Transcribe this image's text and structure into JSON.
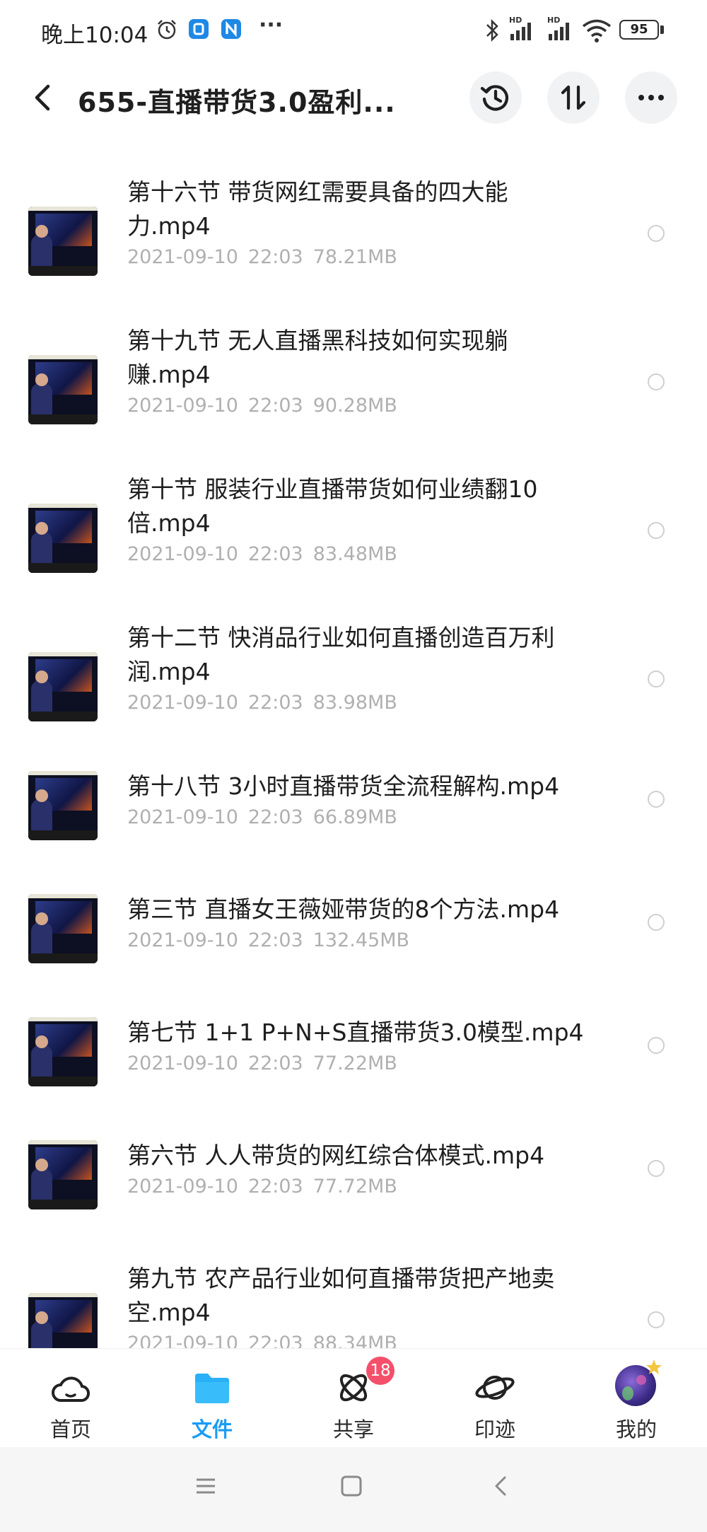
{
  "status_bar": {
    "time": "晚上10:04",
    "more": "···",
    "signal_1_label": "HD",
    "signal_2_label": "HD",
    "battery": "95"
  },
  "header": {
    "title": "655-直播带货3.0盈利..."
  },
  "files": [
    {
      "name": "第十六节 带货网红需要具备的四大能力.mp4",
      "date": "2021-09-10",
      "time": "22:03",
      "size": "78.21MB"
    },
    {
      "name": "第十九节 无人直播黑科技如何实现躺赚.mp4",
      "date": "2021-09-10",
      "time": "22:03",
      "size": "90.28MB"
    },
    {
      "name": "第十节 服装行业直播带货如何业绩翻10倍.mp4",
      "date": "2021-09-10",
      "time": "22:03",
      "size": "83.48MB"
    },
    {
      "name": "第十二节 快消品行业如何直播创造百万利润.mp4",
      "date": "2021-09-10",
      "time": "22:03",
      "size": "83.98MB"
    },
    {
      "name": "第十八节 3小时直播带货全流程解构.mp4",
      "date": "2021-09-10",
      "time": "22:03",
      "size": "66.89MB"
    },
    {
      "name": "第三节 直播女王薇娅带货的8个方法.mp4",
      "date": "2021-09-10",
      "time": "22:03",
      "size": "132.45MB"
    },
    {
      "name": "第七节 1+1 P+N+S直播带货3.0模型.mp4",
      "date": "2021-09-10",
      "time": "22:03",
      "size": "77.22MB"
    },
    {
      "name": "第六节 人人带货的网红综合体模式.mp4",
      "date": "2021-09-10",
      "time": "22:03",
      "size": "77.72MB"
    },
    {
      "name": "第九节 农产品行业如何直播带货把产地卖空.mp4",
      "date": "2021-09-10",
      "time": "22:03",
      "size": "88.34MB"
    }
  ],
  "tabs": [
    {
      "label": "首页",
      "icon": "cloud-icon"
    },
    {
      "label": "文件",
      "icon": "folder-icon",
      "active": true
    },
    {
      "label": "共享",
      "icon": "atom-icon",
      "badge": "18"
    },
    {
      "label": "印迹",
      "icon": "planet-icon"
    },
    {
      "label": "我的",
      "icon": "avatar"
    }
  ],
  "colors": {
    "accent": "#1a9bf4",
    "badge": "#f4506b",
    "meta_text": "#b0b0b0"
  }
}
